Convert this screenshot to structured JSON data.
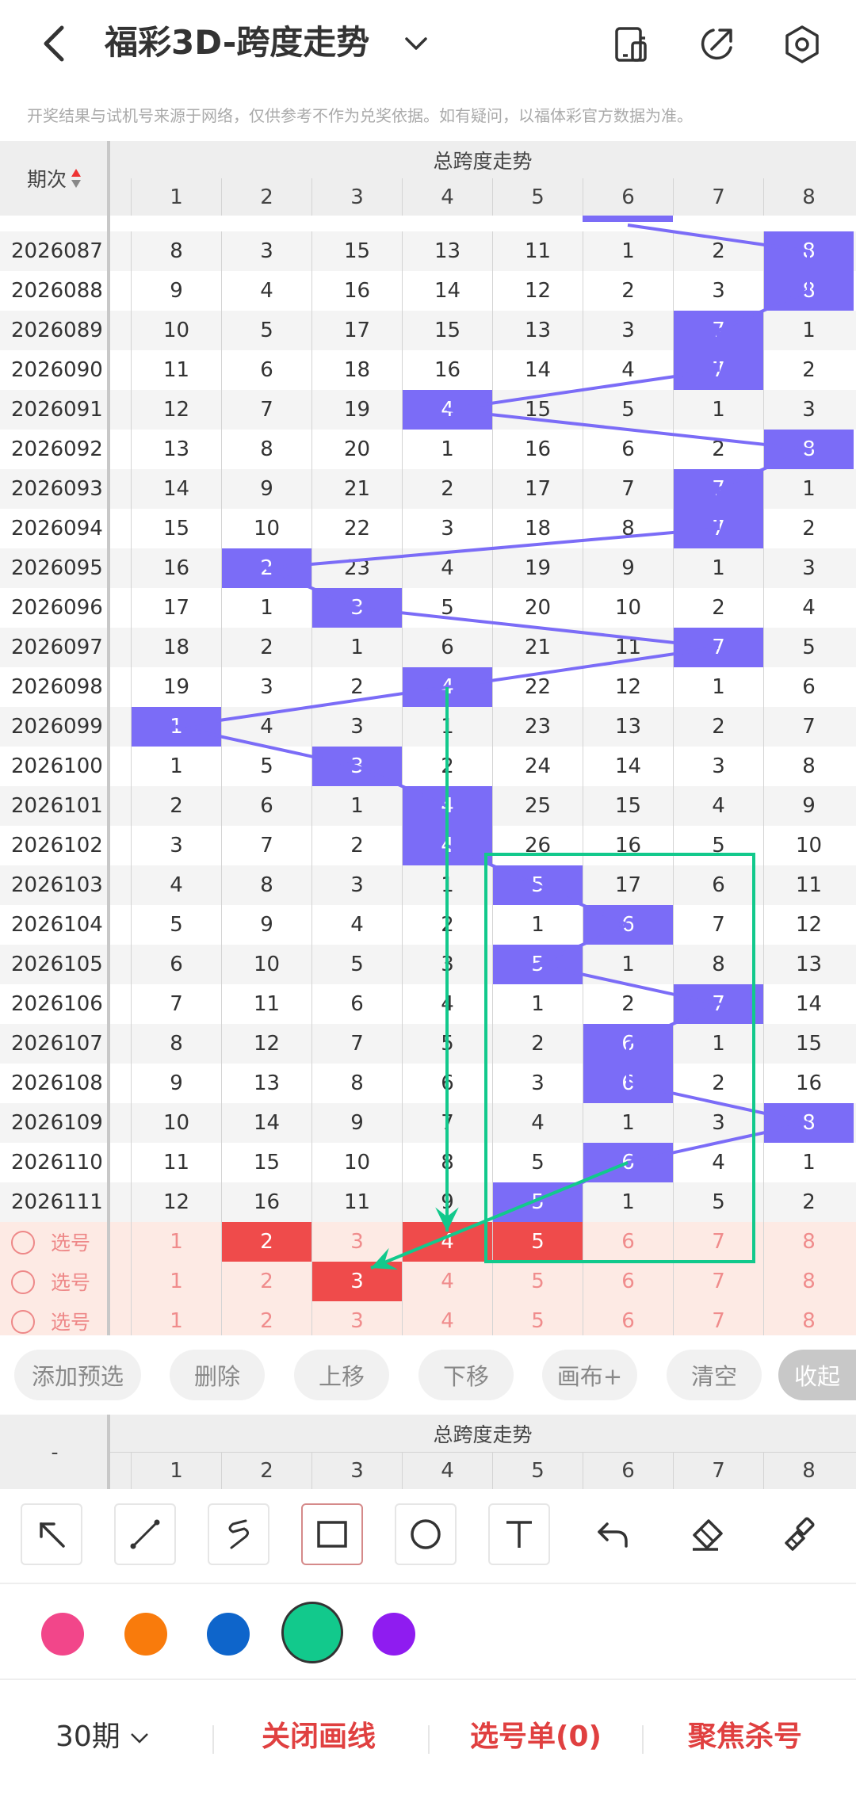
{
  "header": {
    "title": "福彩3D-跨度走势"
  },
  "notice": "开奖结果与试机号来源于网络，仅供参考不作为兑奖依据。如有疑问，以福体彩官方数据为准。",
  "table": {
    "period_header": "期次",
    "group_title": "总跨度走势",
    "columns": [
      "1",
      "2",
      "3",
      "4",
      "5",
      "6",
      "7",
      "8"
    ],
    "rows": [
      {
        "period": "2026087",
        "values": [
          "8",
          "3",
          "15",
          "13",
          "11",
          "1",
          "2",
          "8"
        ],
        "hit": 8
      },
      {
        "period": "2026088",
        "values": [
          "9",
          "4",
          "16",
          "14",
          "12",
          "2",
          "3",
          "8"
        ],
        "hit": 8
      },
      {
        "period": "2026089",
        "values": [
          "10",
          "5",
          "17",
          "15",
          "13",
          "3",
          "7",
          "1"
        ],
        "hit": 7
      },
      {
        "period": "2026090",
        "values": [
          "11",
          "6",
          "18",
          "16",
          "14",
          "4",
          "7",
          "2"
        ],
        "hit": 7
      },
      {
        "period": "2026091",
        "values": [
          "12",
          "7",
          "19",
          "4",
          "15",
          "5",
          "1",
          "3"
        ],
        "hit": 4
      },
      {
        "period": "2026092",
        "values": [
          "13",
          "8",
          "20",
          "1",
          "16",
          "6",
          "2",
          "8"
        ],
        "hit": 8
      },
      {
        "period": "2026093",
        "values": [
          "14",
          "9",
          "21",
          "2",
          "17",
          "7",
          "7",
          "1"
        ],
        "hit": 7
      },
      {
        "period": "2026094",
        "values": [
          "15",
          "10",
          "22",
          "3",
          "18",
          "8",
          "7",
          "2"
        ],
        "hit": 7
      },
      {
        "period": "2026095",
        "values": [
          "16",
          "2",
          "23",
          "4",
          "19",
          "9",
          "1",
          "3"
        ],
        "hit": 2
      },
      {
        "period": "2026096",
        "values": [
          "17",
          "1",
          "3",
          "5",
          "20",
          "10",
          "2",
          "4"
        ],
        "hit": 3
      },
      {
        "period": "2026097",
        "values": [
          "18",
          "2",
          "1",
          "6",
          "21",
          "11",
          "7",
          "5"
        ],
        "hit": 7
      },
      {
        "period": "2026098",
        "values": [
          "19",
          "3",
          "2",
          "4",
          "22",
          "12",
          "1",
          "6"
        ],
        "hit": 4
      },
      {
        "period": "2026099",
        "values": [
          "1",
          "4",
          "3",
          "1",
          "23",
          "13",
          "2",
          "7"
        ],
        "hit": 1
      },
      {
        "period": "2026100",
        "values": [
          "1",
          "5",
          "3",
          "2",
          "24",
          "14",
          "3",
          "8"
        ],
        "hit": 3
      },
      {
        "period": "2026101",
        "values": [
          "2",
          "6",
          "1",
          "4",
          "25",
          "15",
          "4",
          "9"
        ],
        "hit": 4
      },
      {
        "period": "2026102",
        "values": [
          "3",
          "7",
          "2",
          "4",
          "26",
          "16",
          "5",
          "10"
        ],
        "hit": 4
      },
      {
        "period": "2026103",
        "values": [
          "4",
          "8",
          "3",
          "1",
          "5",
          "17",
          "6",
          "11"
        ],
        "hit": 5
      },
      {
        "period": "2026104",
        "values": [
          "5",
          "9",
          "4",
          "2",
          "1",
          "6",
          "7",
          "12"
        ],
        "hit": 6
      },
      {
        "period": "2026105",
        "values": [
          "6",
          "10",
          "5",
          "3",
          "5",
          "1",
          "8",
          "13"
        ],
        "hit": 5
      },
      {
        "period": "2026106",
        "values": [
          "7",
          "11",
          "6",
          "4",
          "1",
          "2",
          "7",
          "14"
        ],
        "hit": 7
      },
      {
        "period": "2026107",
        "values": [
          "8",
          "12",
          "7",
          "5",
          "2",
          "6",
          "1",
          "15"
        ],
        "hit": 6
      },
      {
        "period": "2026108",
        "values": [
          "9",
          "13",
          "8",
          "6",
          "3",
          "6",
          "2",
          "16"
        ],
        "hit": 6
      },
      {
        "period": "2026109",
        "values": [
          "10",
          "14",
          "9",
          "7",
          "4",
          "1",
          "3",
          "8"
        ],
        "hit": 8
      },
      {
        "period": "2026110",
        "values": [
          "11",
          "15",
          "10",
          "8",
          "5",
          "6",
          "4",
          "1"
        ],
        "hit": 6
      },
      {
        "period": "2026111",
        "values": [
          "12",
          "16",
          "11",
          "9",
          "5",
          "1",
          "5",
          "2"
        ],
        "hit": 5
      }
    ],
    "select_rows": [
      {
        "label": "选号",
        "values": [
          "1",
          "2",
          "3",
          "4",
          "5",
          "6",
          "7",
          "8"
        ],
        "selected": [
          2,
          4,
          5
        ]
      },
      {
        "label": "选号",
        "values": [
          "1",
          "2",
          "3",
          "4",
          "5",
          "6",
          "7",
          "8"
        ],
        "selected": [
          3
        ]
      },
      {
        "label": "选号",
        "values": [
          "1",
          "2",
          "3",
          "4",
          "5",
          "6",
          "7",
          "8"
        ],
        "selected": []
      }
    ]
  },
  "toolbar": {
    "buttons": [
      "添加预选",
      "删除",
      "上移",
      "下移",
      "画布+",
      "清空",
      "收起"
    ]
  },
  "bottom_header": {
    "period": "-",
    "group_title": "总跨度走势",
    "columns": [
      "1",
      "2",
      "3",
      "4",
      "5",
      "6",
      "7",
      "8"
    ]
  },
  "draw_tools": [
    "arrow-tool",
    "line-tool",
    "curve-tool",
    "rectangle-tool",
    "circle-tool",
    "text-tool",
    "undo-tool",
    "eraser-tool",
    "clear-brush-tool"
  ],
  "colors": {
    "pink": "#f2468a",
    "orange": "#f97b0c",
    "blue": "#0e65cb",
    "green": "#12c98c",
    "purple": "#8f1cf0",
    "hit": "#7b6cf7",
    "selected": "#ef4b4b"
  },
  "footer": {
    "periods": "30期",
    "close_draw": "关闭画线",
    "selection": "选号单(0)",
    "focus": "聚焦杀号"
  }
}
